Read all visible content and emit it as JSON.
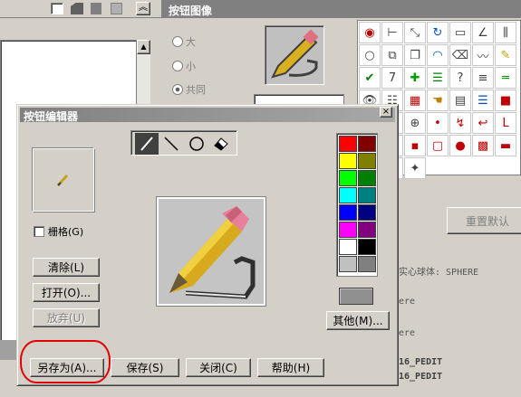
{
  "background": {
    "window_title": "按钮图像",
    "size_options": [
      "大",
      "小",
      "共同"
    ],
    "reset_label": "重置默认",
    "code_lines": [
      "实心球体:  SPHERE",
      "ere",
      "ere",
      "16_PEDIT",
      "16_PEDIT"
    ],
    "icons": [
      "target-icon",
      "dimension-icon",
      "diagonal-icon",
      "rotate-icon",
      "rect-icon",
      "angle-icon",
      "tri-bars-icon",
      "circle-icon",
      "mirror-icon",
      "copy-icon",
      "arc-icon",
      "eraser-icon",
      "wave-icon",
      "edit-icon",
      "check-icon",
      "seven-icon",
      "plus-icon",
      "list-icon",
      "help-icon",
      "lines-icon",
      "h-bars-icon",
      "eye-icon",
      "stack-icon",
      "block-icon",
      "pan-icon",
      "calc-icon",
      "list-bars-icon",
      "red-square-icon",
      "smile-icon",
      "pin-icon",
      "zoom-icon",
      "dot-icon",
      "zigzag-icon",
      "hook-icon",
      "L-icon",
      "corner-icon",
      "box-icon",
      "mini-red-icon",
      "red-frame-icon",
      "red-dot-icon",
      "hatch-icon",
      "dash-icon",
      "minus-icon",
      "square-icon",
      "glyph-icon"
    ]
  },
  "dialog": {
    "title": "按钮编辑器",
    "close_label": "×",
    "grid_label": "栅格(G)",
    "buttons": {
      "clear": "清除(L)",
      "open": "打开(O)...",
      "undo": "放弃(U)",
      "other": "其他(M)...",
      "save_as": "另存为(A)...",
      "save": "保存(S)",
      "close": "关闭(C)",
      "help": "帮助(H)"
    },
    "tools": [
      "pencil-tool-icon",
      "line-tool-icon",
      "circle-tool-icon",
      "eraser-tool-icon"
    ],
    "palette": [
      "#ff0000",
      "#800000",
      "#ffff00",
      "#808000",
      "#00ff00",
      "#008000",
      "#00ffff",
      "#008080",
      "#0000ff",
      "#000080",
      "#ff00ff",
      "#800080",
      "#ffffff",
      "#000000",
      "#c0c0c0",
      "#808080"
    ],
    "current_color": "#909090"
  },
  "annotation_color": "#e00000"
}
